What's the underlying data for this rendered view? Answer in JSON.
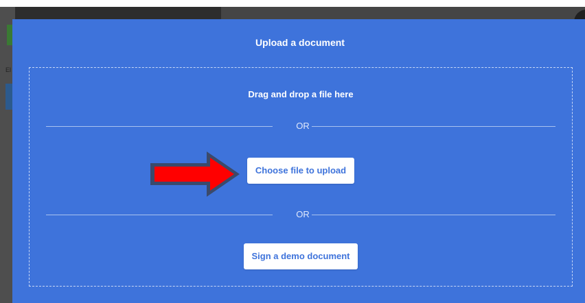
{
  "background": {
    "cropped_text": "El"
  },
  "modal": {
    "title": "Upload a document",
    "dropzone": {
      "drag_text": "Drag and drop a file here",
      "or_label_1": "OR",
      "choose_button": "Choose file to upload",
      "or_label_2": "OR",
      "demo_button": "Sign a demo document"
    },
    "annotation": {
      "icon": "arrow-right-icon",
      "color": "#ff0000",
      "outline": "#3b4a6b"
    }
  },
  "colors": {
    "modal_background": "#3e73db",
    "button_background": "#ffffff",
    "button_text": "#3e73db"
  }
}
